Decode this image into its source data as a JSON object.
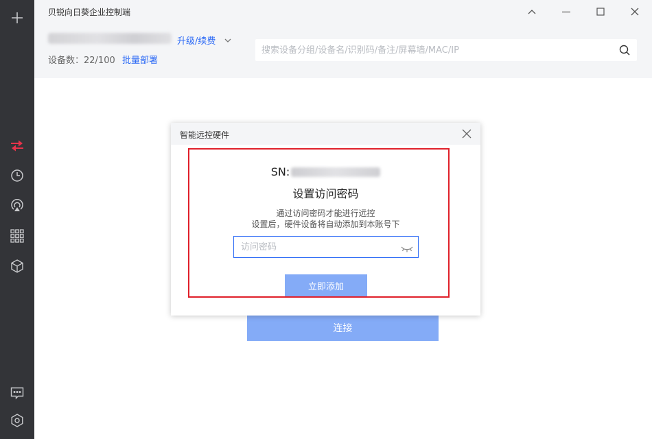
{
  "window": {
    "title": "贝锐向日葵企业控制端"
  },
  "header": {
    "upgrade_label": "升级/续费",
    "device_count_label": "设备数：22/100",
    "bulk_deploy_label": "批量部署",
    "search_placeholder": "搜索设备分组/设备名/识别码/备注/屏幕墙/MAC/IP"
  },
  "sidebar": {
    "icons": [
      "add-icon",
      "remote-control-icon",
      "history-icon",
      "cast-icon",
      "apps-icon",
      "cube-icon",
      "message-icon",
      "settings-icon"
    ],
    "active_color": "#e8334a"
  },
  "main": {
    "connect_label": "连接"
  },
  "dialog": {
    "title": "智能远控硬件",
    "sn_label": "SN:",
    "heading": "设置访问密码",
    "desc_line1": "通过访问密码才能进行远控",
    "desc_line2": "设置后，硬件设备将自动添加到本账号下",
    "password_placeholder": "访问密码",
    "submit_label": "立即添加"
  },
  "colors": {
    "accent": "#2f6cf6",
    "button_disabled": "#84abf7",
    "highlight_border": "#e0202a",
    "sidebar_bg": "#333438"
  }
}
